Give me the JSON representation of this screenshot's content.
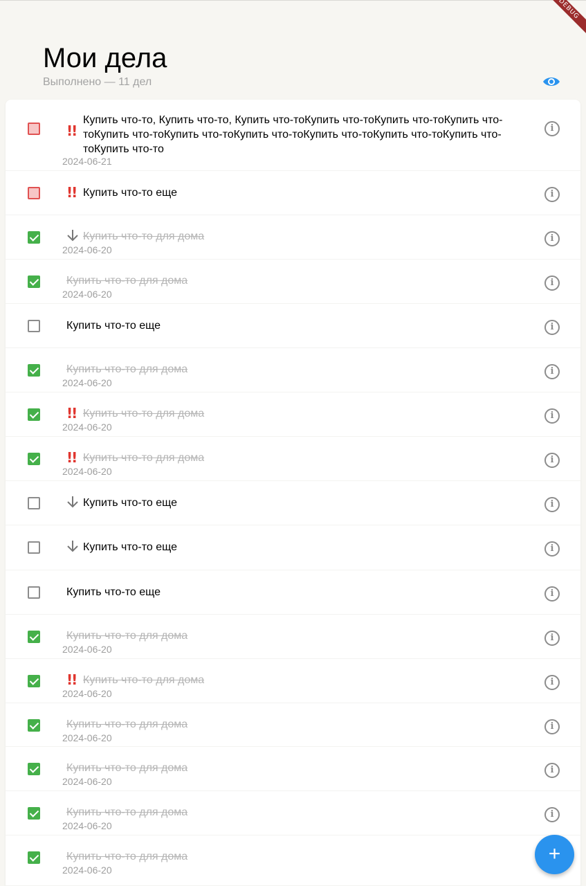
{
  "header": {
    "title": "Мои дела",
    "completed_label": "Выполнено — 11 дел",
    "debug_banner": "DEBUG",
    "accent_color": "#2a93ee"
  },
  "tasks": [
    {
      "text": "Купить что-то, Купить что-то, Купить что-тоКупить что-тоКупить что-тоКупить что-тоКупить что-тоКупить что-тоКупить что-тоКупить что-тоКупить что-тоКупить что-тоКупить что-то",
      "date": "2024-06-21",
      "done": false,
      "priority": "high",
      "checkbox": "urgent"
    },
    {
      "text": "Купить что-то еще",
      "date": "",
      "done": false,
      "priority": "high",
      "checkbox": "urgent"
    },
    {
      "text": "Купить что-то для дома",
      "date": "2024-06-20",
      "done": true,
      "priority": "low"
    },
    {
      "text": "Купить что-то для дома",
      "date": "2024-06-20",
      "done": true,
      "priority": "none"
    },
    {
      "text": "Купить что-то еще",
      "date": "",
      "done": false,
      "priority": "none"
    },
    {
      "text": "Купить что-то для дома",
      "date": "2024-06-20",
      "done": true,
      "priority": "none"
    },
    {
      "text": "Купить что-то для дома",
      "date": "2024-06-20",
      "done": true,
      "priority": "high"
    },
    {
      "text": "Купить что-то для дома",
      "date": "2024-06-20",
      "done": true,
      "priority": "high"
    },
    {
      "text": "Купить что-то еще",
      "date": "",
      "done": false,
      "priority": "low"
    },
    {
      "text": "Купить что-то еще",
      "date": "",
      "done": false,
      "priority": "low"
    },
    {
      "text": "Купить что-то еще",
      "date": "",
      "done": false,
      "priority": "none"
    },
    {
      "text": "Купить что-то для дома",
      "date": "2024-06-20",
      "done": true,
      "priority": "none"
    },
    {
      "text": "Купить что-то для дома",
      "date": "2024-06-20",
      "done": true,
      "priority": "high"
    },
    {
      "text": "Купить что-то для дома",
      "date": "2024-06-20",
      "done": true,
      "priority": "none"
    },
    {
      "text": "Купить что-то для дома",
      "date": "2024-06-20",
      "done": true,
      "priority": "none"
    },
    {
      "text": "Купить что-то для дома",
      "date": "2024-06-20",
      "done": true,
      "priority": "none"
    },
    {
      "text": "Купить что-то для дома",
      "date": "2024-06-20",
      "done": true,
      "priority": "none"
    }
  ],
  "icons": {
    "visibility": "eye-icon",
    "info": "info-icon",
    "add": "plus-icon",
    "priority_high": "double-exclamation-icon",
    "priority_low": "arrow-down-icon"
  },
  "fab": {
    "label": "+"
  },
  "colors": {
    "done_checkbox": "#45b04a",
    "urgent_checkbox_fill": "#f7c6c6",
    "urgent_checkbox_border": "#e05252",
    "priority_high": "#e0362f",
    "background": "#f7f6f2"
  }
}
